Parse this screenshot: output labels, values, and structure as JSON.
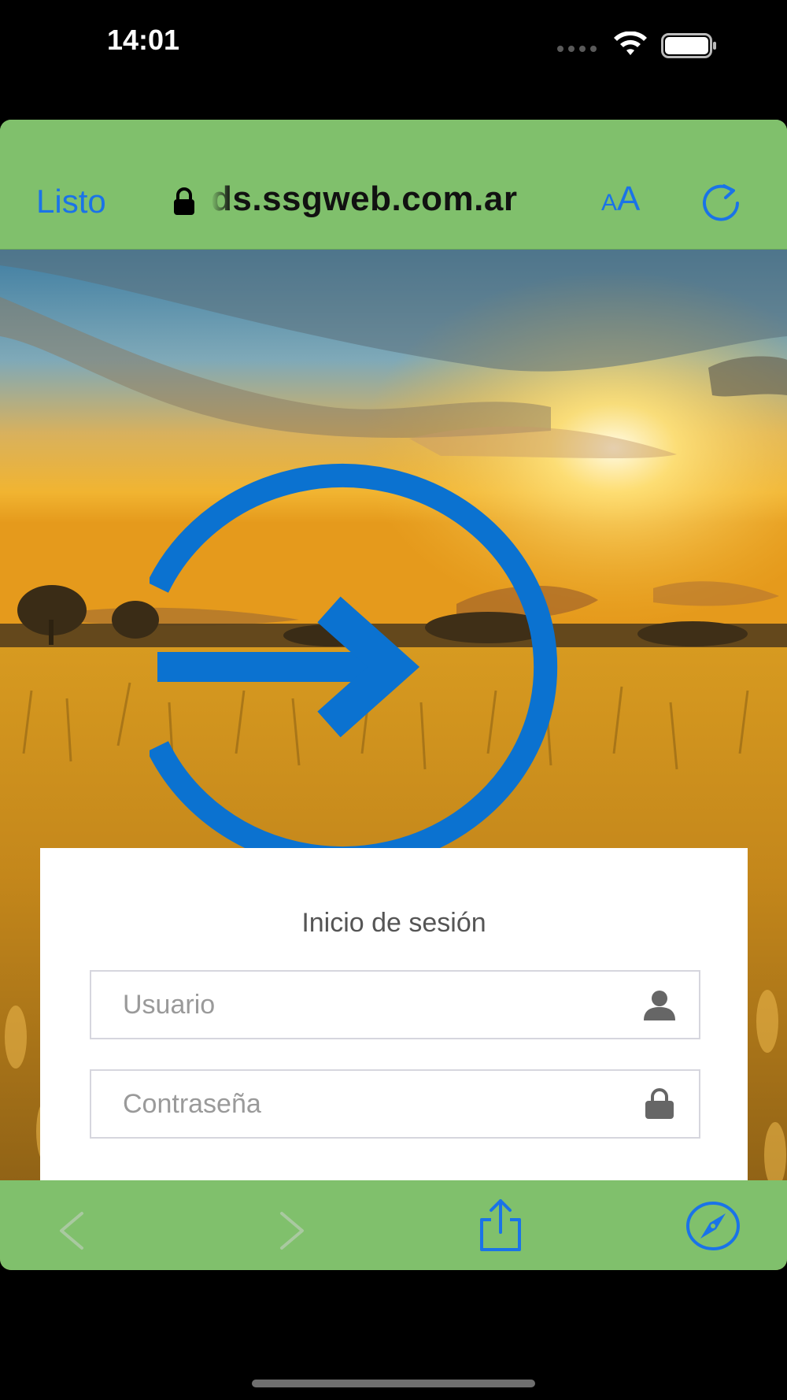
{
  "status_bar": {
    "time": "14:01"
  },
  "browser": {
    "done_label": "Listo",
    "url": "ds.ssgweb.com.ar",
    "text_size_small": "A",
    "text_size_big": "A"
  },
  "login": {
    "title": "Inicio de sesión",
    "username_placeholder": "Usuario",
    "password_placeholder": "Contraseña"
  },
  "colors": {
    "toolbar_green": "#80c06c",
    "accent_blue": "#1a73e8",
    "login_icon_blue": "#0b72d0"
  },
  "icons": {
    "lock": "lock-icon",
    "reload": "reload-icon",
    "login_arrow": "login-arrow-icon",
    "user": "user-icon",
    "password_lock": "lock-icon",
    "back": "chevron-left-icon",
    "forward": "chevron-right-icon",
    "share": "share-icon",
    "safari": "compass-icon"
  }
}
